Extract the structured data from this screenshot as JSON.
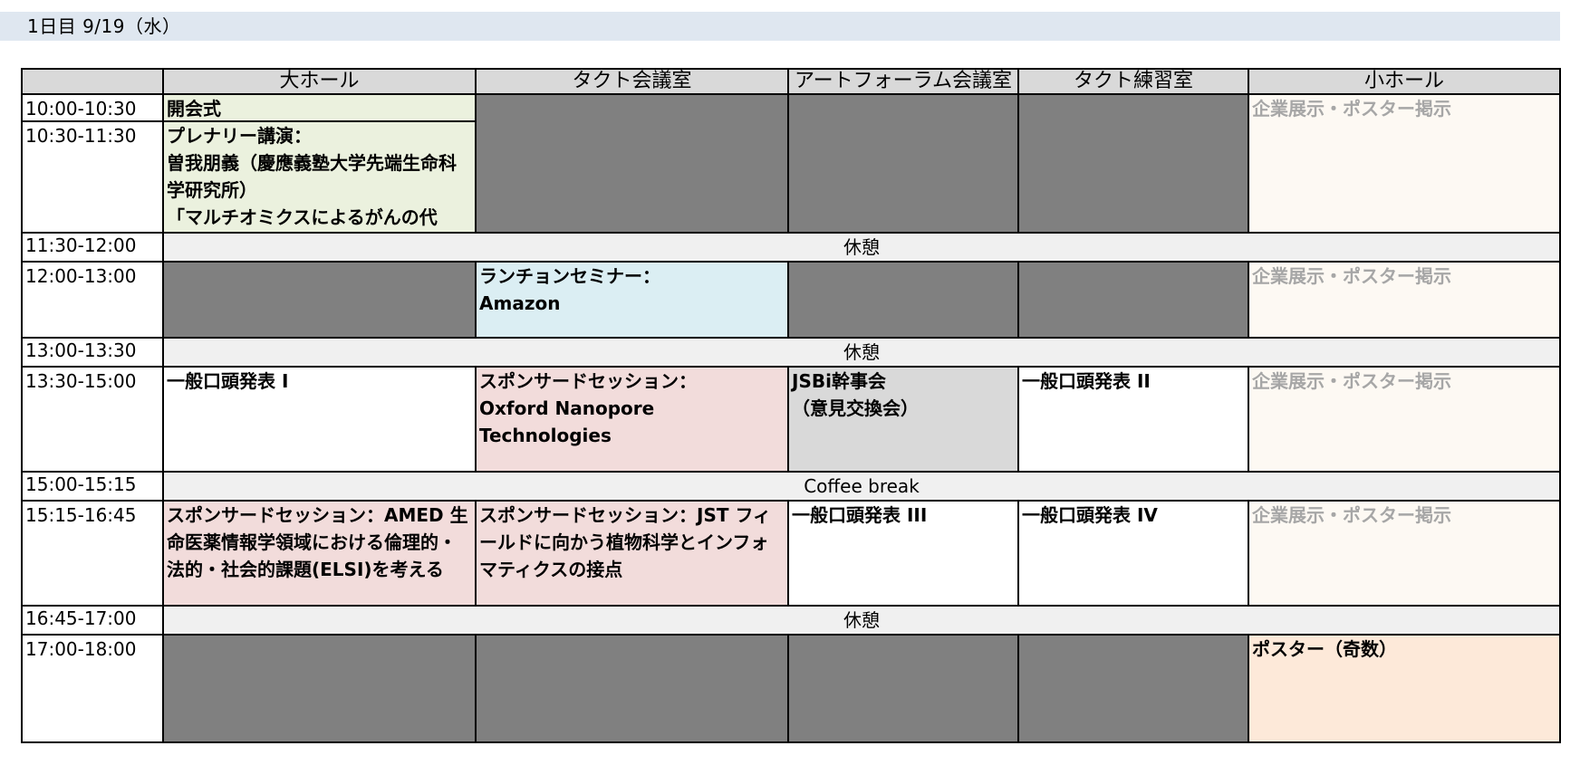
{
  "day_header": "1日目 9/19（水）",
  "rooms": [
    "大ホール",
    "タクト会議室",
    "アートフォーラム会議室",
    "タクト練習室",
    "小ホール"
  ],
  "times": {
    "t1000": "10:00-10:30",
    "t1030": "10:30-11:30",
    "t1130": "11:30-12:00",
    "t1200": "12:00-13:00",
    "t1300": "13:00-13:30",
    "t1330": "13:30-15:00",
    "t1500": "15:00-15:15",
    "t1515": "15:15-16:45",
    "t1645": "16:45-17:00",
    "t1700": "17:00-18:00"
  },
  "sessions": {
    "opening": "開会式",
    "plenary_title": "プレナリー講演：",
    "plenary_speaker": "曽我朋義（慶應義塾大学先端生命科学研究所）",
    "plenary_talk": "「マルチオミクスによるがんの代",
    "break1": "休憩",
    "lunch_title": "ランチョンセミナー：",
    "lunch_sponsor": "Amazon",
    "break2": "休憩",
    "oral1": "一般口頭発表 I",
    "sponsored1_title": "スポンサードセッション：",
    "sponsored1_sponsor": "Oxford Nanopore Technologies",
    "jsbi_line1": "JSBi幹事会",
    "jsbi_line2": "（意見交換会）",
    "oral2": "一般口頭発表 II",
    "coffee": "Coffee break",
    "amed": "スポンサードセッション：AMED 生命医薬情報学領域における倫理的・法的・社会的課題(ELSI)を考える",
    "jst": "スポンサードセッション：JST フィールドに向かう植物科学とインフォマティクスの接点",
    "oral3": "一般口頭発表 III",
    "oral4": "一般口頭発表 IV",
    "break3": "休憩",
    "poster": "ポスター（奇数）",
    "exhibit1": "企業展示・ポスター掲示",
    "exhibit2": "企業展示・ポスター掲示",
    "exhibit3": "企業展示・ポスター掲示",
    "exhibit4": "企業展示・ポスター掲示"
  }
}
